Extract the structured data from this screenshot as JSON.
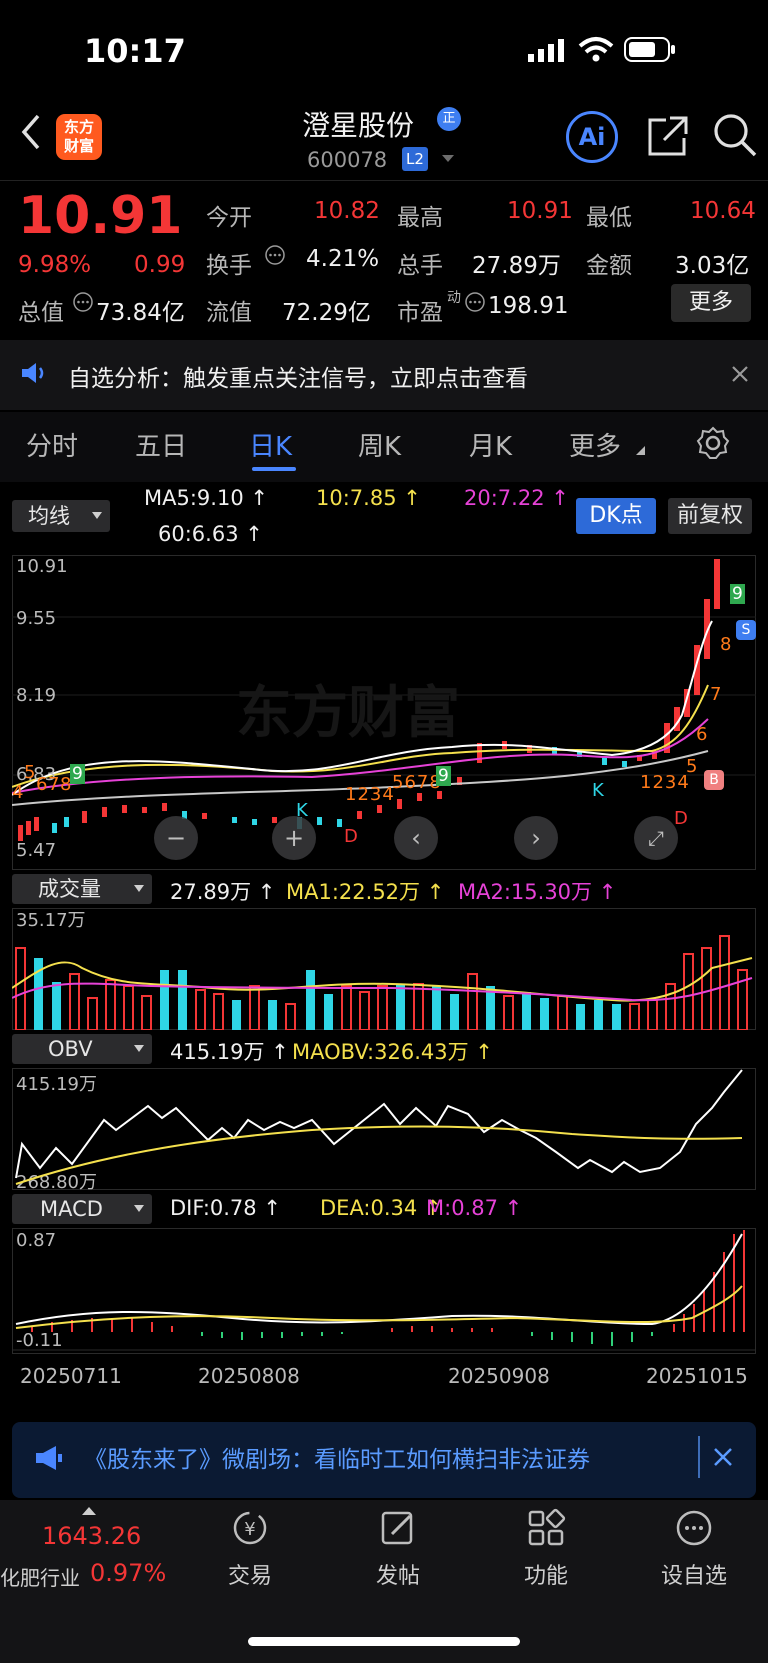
{
  "status_bar": {
    "time": "10:17"
  },
  "header": {
    "logo_line1": "东方",
    "logo_line2": "财富",
    "stock_name": "澄星股份",
    "badge": "正",
    "code": "600078",
    "level": "L2",
    "ai_label": "Ai"
  },
  "quote": {
    "price": "10.91",
    "change_pct": "9.98%",
    "change_amt": "0.99",
    "fields": {
      "open_label": "今开",
      "open": "10.82",
      "high_label": "最高",
      "high": "10.91",
      "low_label": "最低",
      "low": "10.64",
      "turnover_label": "换手",
      "turnover": "4.21%",
      "volume_label": "总手",
      "volume": "27.89万",
      "amount_label": "金额",
      "amount": "3.03亿",
      "mktcap_label": "总值",
      "mktcap": "73.84亿",
      "float_label": "流值",
      "float_cap": "72.29亿",
      "pe_label": "市盈",
      "pe_sup": "动",
      "pe": "198.91"
    },
    "more": "更多"
  },
  "notice": {
    "text": "自选分析：触发重点关注信号，立即点击查看"
  },
  "tabs": [
    "分时",
    "五日",
    "日K",
    "周K",
    "月K",
    "更多"
  ],
  "active_tab": "日K",
  "ma_bar": {
    "selector": "均线",
    "ma5": "MA5:9.10",
    "ma10": "10:7.85",
    "ma20": "20:7.22",
    "ma60": "60:6.63",
    "dk_button": "DK点",
    "adjust_button": "前复权"
  },
  "kline": {
    "y_labels": [
      "10.91",
      "9.55",
      "8.19",
      "6.83",
      "5.47"
    ],
    "watermark": "东方财富",
    "marker_left": [
      "4",
      "5",
      "6",
      "7",
      "8",
      "9"
    ],
    "marker_mid": [
      "1",
      "2",
      "3",
      "4",
      "5",
      "6",
      "7",
      "8",
      "9"
    ],
    "marker_right_low": [
      "1",
      "2",
      "3",
      "4",
      "5"
    ],
    "marker_right_high": [
      "6",
      "7",
      "8",
      "9"
    ],
    "k_label": "K",
    "d_label": "D",
    "b_label": "B",
    "s_label": "S"
  },
  "volume_panel": {
    "selector": "成交量",
    "value": "27.89万",
    "ma1": "MA1:22.52万",
    "ma2": "MA2:15.30万",
    "y_top": "35.17万"
  },
  "obv_panel": {
    "selector": "OBV",
    "value": "415.19万",
    "maobv": "MAOBV:326.43万",
    "y_top": "415.19万",
    "y_bottom": "268.80万"
  },
  "macd_panel": {
    "selector": "MACD",
    "dif": "DIF:0.78",
    "dea": "DEA:0.34",
    "m": "M:0.87",
    "y_top": "0.87",
    "y_bottom": "-0.11"
  },
  "dates": [
    "20250711",
    "20250808",
    "20250908",
    "20251015"
  ],
  "promo": {
    "text": "《股东来了》微剧场：看临时工如何横扫非法证券"
  },
  "bottom_nav": {
    "index_value": "1643.26",
    "industry": "化肥行业",
    "industry_pct": "0.97%",
    "items": [
      "交易",
      "发帖",
      "功能",
      "设自选"
    ]
  },
  "colors": {
    "up": "#f43636",
    "down": "#2fd079",
    "accent": "#4a86ff",
    "ma5": "#ffffff",
    "ma10": "#f4e04d",
    "ma20": "#e642d7",
    "ma60": "#c8c8c8",
    "cyan": "#2fd6e6"
  }
}
